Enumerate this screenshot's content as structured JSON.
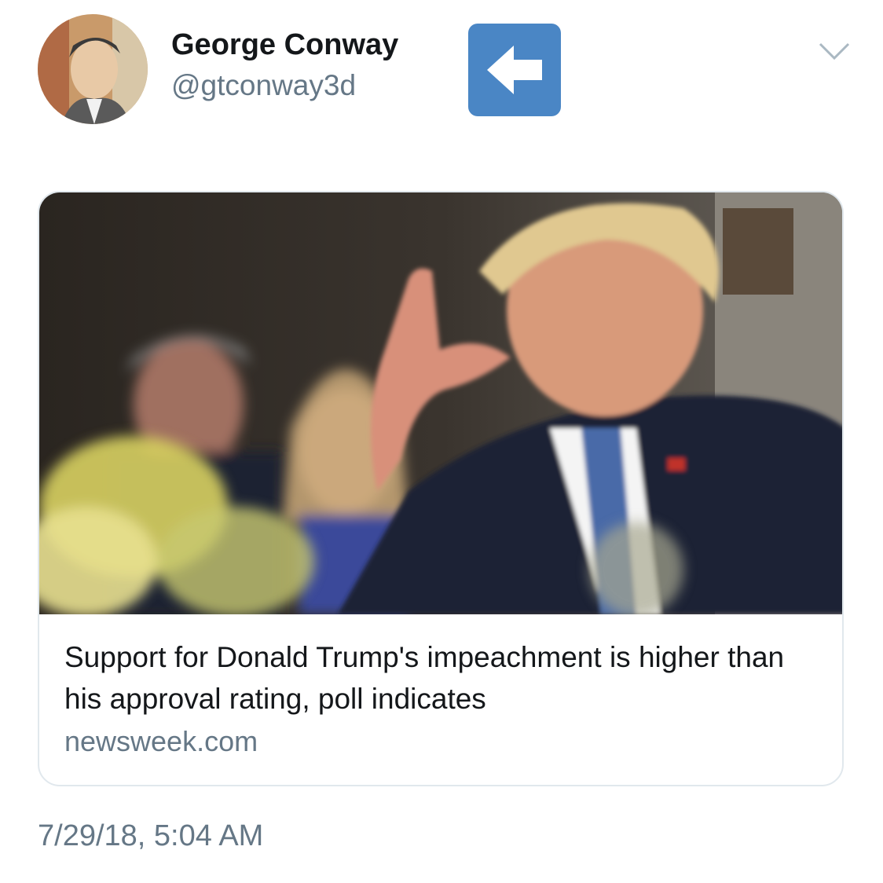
{
  "tweet": {
    "author": {
      "display_name": "George Conway",
      "handle": "@gtconway3d",
      "avatar_icon": "avatar-sketch-portrait"
    },
    "emoji": "left-arrow-emoji",
    "menu_icon": "chevron-down-icon",
    "card": {
      "image_icon": "news-photo",
      "title": "Support for Donald Trump's impeachment is higher than his approval rating, poll indicates",
      "domain": "newsweek.com"
    },
    "timestamp": "7/29/18, 5:04 AM"
  },
  "colors": {
    "text_primary": "#14171a",
    "text_secondary": "#657786",
    "card_border": "#e1e8ed",
    "emoji_blue": "#4a86c5"
  }
}
